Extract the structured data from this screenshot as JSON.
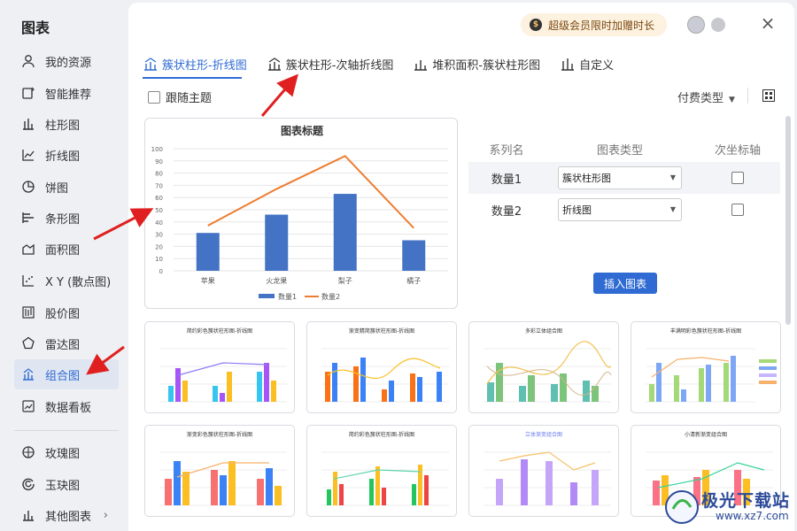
{
  "app": {
    "title": "图表"
  },
  "sidebar": {
    "items": [
      {
        "label": "我的资源",
        "icon": "user-icon"
      },
      {
        "label": "智能推荐",
        "icon": "recommend-icon"
      },
      {
        "label": "柱形图",
        "icon": "bar-chart-icon"
      },
      {
        "label": "折线图",
        "icon": "line-chart-icon"
      },
      {
        "label": "饼图",
        "icon": "pie-chart-icon"
      },
      {
        "label": "条形图",
        "icon": "horizontal-bar-icon"
      },
      {
        "label": "面积图",
        "icon": "area-chart-icon"
      },
      {
        "label": "X Y (散点图)",
        "icon": "scatter-icon"
      },
      {
        "label": "股价图",
        "icon": "stock-chart-icon"
      },
      {
        "label": "雷达图",
        "icon": "radar-chart-icon"
      },
      {
        "label": "组合图",
        "icon": "combo-chart-icon",
        "active": true
      },
      {
        "label": "数据看板",
        "icon": "dashboard-icon"
      },
      {
        "label": "玫瑰图",
        "icon": "rose-chart-icon"
      },
      {
        "label": "玉玦图",
        "icon": "ring-chart-icon"
      },
      {
        "label": "其他图表",
        "icon": "more-charts-icon"
      }
    ]
  },
  "header": {
    "promo": "超级会员限时加赠时长",
    "promo_icon": "coin-icon"
  },
  "tabs": [
    {
      "label": "簇状柱形-折线图",
      "active": true
    },
    {
      "label": "簇状柱形-次轴折线图"
    },
    {
      "label": "堆积面积-簇状柱形图"
    },
    {
      "label": "自定义"
    }
  ],
  "toolbar": {
    "follow_theme": "跟随主题",
    "paid_type": "付费类型"
  },
  "settings": {
    "headers": [
      "系列名",
      "图表类型",
      "次坐标轴"
    ],
    "rows": [
      {
        "name": "数量1",
        "type": "簇状柱形图"
      },
      {
        "name": "数量2",
        "type": "折线图"
      }
    ],
    "insert_button": "插入图表"
  },
  "chart_data": {
    "type": "bar",
    "title": "图表标题",
    "categories": [
      "苹果",
      "火龙果",
      "梨子",
      "橘子"
    ],
    "series": [
      {
        "name": "数量1",
        "type": "bar",
        "values": [
          31,
          46,
          63,
          25
        ],
        "color": "#4472c4"
      },
      {
        "name": "数量2",
        "type": "line",
        "values": [
          37,
          67,
          94,
          35
        ],
        "color": "#ed7d31"
      }
    ],
    "ylim": [
      0,
      100
    ],
    "yticks": [
      0,
      10,
      20,
      30,
      40,
      50,
      60,
      70,
      80,
      90,
      100
    ],
    "grid": true,
    "legend": "bottom"
  },
  "templates": [
    "简约彩色簇状柱形图-折线图",
    "渐变精简簇状柱形图-折线图",
    "多彩立体组合图",
    "丰满明彩色簇状柱形图-折线图",
    "渐变彩色簇状柱形图-折线图",
    "简约彩色簇状柱形图-折线图",
    "立体渐变组合图",
    "小清新渐变组合图"
  ],
  "watermark": {
    "text": "极光下载站",
    "url": "www.xz7.com"
  },
  "colors": {
    "accent": "#2f6bd3",
    "bar": "#4472c4",
    "line": "#ed7d31"
  }
}
